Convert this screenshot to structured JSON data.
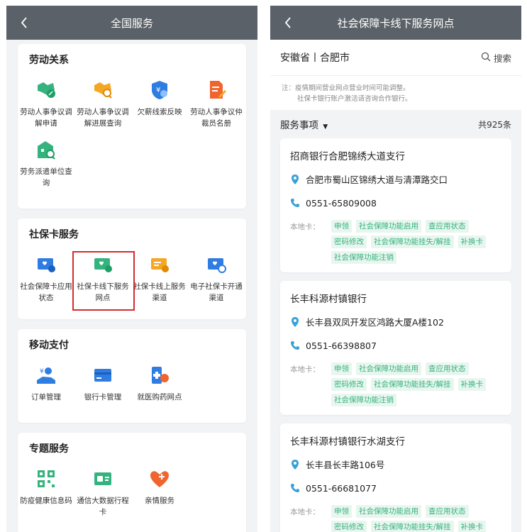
{
  "left": {
    "nav_title": "全国服务",
    "sections": [
      {
        "title": "劳动关系",
        "items": [
          {
            "label": "劳动人事争议调解申请",
            "icon": "handshake-pen-icon"
          },
          {
            "label": "劳动人事争议调解进展查询",
            "icon": "handshake-search-icon"
          },
          {
            "label": "欠薪线索反映",
            "icon": "shield-yen-icon"
          },
          {
            "label": "劳动人事争议仲裁员名册",
            "icon": "document-pen-icon"
          },
          {
            "label": "劳务派遣单位查询",
            "icon": "building-search-icon"
          }
        ]
      },
      {
        "title": "社保卡服务",
        "items": [
          {
            "label": "社会保障卡应用状态",
            "icon": "card-heart-icon"
          },
          {
            "label": "社保卡线下服务网点",
            "icon": "card-location-icon"
          },
          {
            "label": "社保卡线上服务渠道",
            "icon": "card-online-icon"
          },
          {
            "label": "电子社保卡开通渠道",
            "icon": "card-ecard-icon"
          }
        ]
      },
      {
        "title": "移动支付",
        "items": [
          {
            "label": "订单管理",
            "icon": "hand-coin-icon"
          },
          {
            "label": "银行卡管理",
            "icon": "bank-card-icon"
          },
          {
            "label": "就医购药网点",
            "icon": "medical-location-icon"
          }
        ]
      },
      {
        "title": "专题服务",
        "items": [
          {
            "label": "防疫健康信息码",
            "icon": "qr-code-icon"
          },
          {
            "label": "通信大数据行程卡",
            "icon": "travel-card-icon"
          },
          {
            "label": "亲情服务",
            "icon": "heart-plus-icon"
          }
        ]
      }
    ]
  },
  "right": {
    "nav_title": "社会保障卡线下服务网点",
    "location": "安徽省丨合肥市",
    "search_label": "搜索",
    "notice_line1": "注：疫情期间营业网点营业时间可能调整。",
    "notice_line2": "社保卡银行账户激活请咨询合作银行。",
    "filter_label": "服务事项",
    "count_text": "共925条",
    "tags_label": "本地卡：",
    "tags": [
      "申领",
      "社会保障功能启用",
      "查应用状态",
      "密码修改",
      "社会保障功能挂失/解挂",
      "补换卡",
      "社会保障功能注销"
    ],
    "banks": [
      {
        "name": "招商银行合肥锦绣大道支行",
        "address": "合肥市蜀山区锦绣大道与清潭路交口",
        "phone": "0551-65809008"
      },
      {
        "name": "长丰科源村镇银行",
        "address": "长丰县双凤开发区鸿路大厦A楼102",
        "phone": "0551-66398807"
      },
      {
        "name": "长丰科源村镇银行水湖支行",
        "address": "长丰县长丰路106号",
        "phone": "0551-66681077"
      }
    ]
  },
  "colors": {
    "nav_bg": "#5b6168",
    "green": "#35b37e",
    "blue": "#2f7de1",
    "orange": "#f5a623",
    "highlight": "#d62b2b"
  }
}
